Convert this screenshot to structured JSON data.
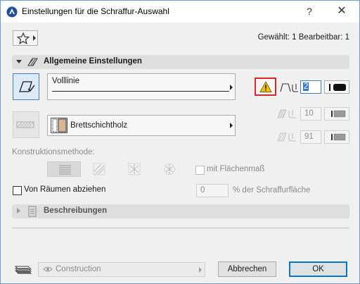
{
  "window": {
    "title": "Einstellungen für die Schraffur-Auswahl",
    "help_label": "?",
    "close_label": "✕"
  },
  "header": {
    "selection_info": "Gewählt: 1 Bearbeitbar: 1"
  },
  "general_section": {
    "label": "Allgemeine Einstellungen"
  },
  "line_type": {
    "label": "Volllinie"
  },
  "pen": {
    "value": "2"
  },
  "fill": {
    "label": "Brettschichtholz",
    "background_pen": "10",
    "foreground_pen": "91"
  },
  "construction": {
    "label": "Konstruktionsmethode:",
    "with_area_label": "mit Flächenmaß"
  },
  "rooms": {
    "checkbox_label": "Von Räumen abziehen",
    "percent_value": "0",
    "percent_label": "% der Schraffurfläche"
  },
  "descriptions_section": {
    "label": "Beschreibungen"
  },
  "footer": {
    "layer_label": "Construction",
    "cancel_label": "Abbrechen",
    "ok_label": "OK"
  },
  "colors": {
    "accent": "#3c7fc7",
    "warning_border": "#e0262b",
    "warning_fill": "#f5c400",
    "wood_swatch": "#d8b894"
  }
}
